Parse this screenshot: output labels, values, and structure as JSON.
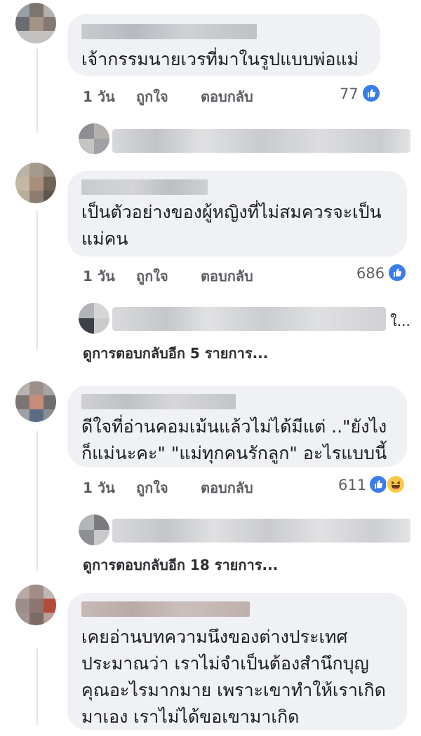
{
  "comments": [
    {
      "text": "เจ้ากรรมนายเวรที่มาในรูปแบบพ่อแม่",
      "time": "1 วัน",
      "like": "ถูกใจ",
      "reply": "ตอบกลับ",
      "reaction_count": "77"
    },
    {
      "text": "เป็นตัวอย่างของผู้หญิงที่ไม่สมควรจะเป็น\nแม่คน",
      "time": "1 วัน",
      "like": "ถูกใจ",
      "reply": "ตอบกลับ",
      "reaction_count": "686",
      "reply_preview_suffix": "ใ...",
      "more_replies": "ดูการตอบกลับอีก 5 รายการ..."
    },
    {
      "text": "ดีใจที่อ่านคอมเม้นแล้วไม่ได้มีแต่ ..\"ยังไง\nก็แม่นะคะ\" \"แม่ทุกคนรักลูก\"  อะไรแบบนี้",
      "time": "1 วัน",
      "like": "ถูกใจ",
      "reply": "ตอบกลับ",
      "reaction_count": "611",
      "more_replies": "ดูการตอบกลับอีก 18 รายการ..."
    },
    {
      "text": "เคยอ่านบทความนึงของต่างประเทศ\nประมาณว่า เราไม่จำเป็นต้องสำนึกบุญ\nคุณอะไรมากมาย เพราะเขาทำให้เราเกิด\nมาเอง เราไม่ได้ขอเขามาเกิด"
    }
  ],
  "icons": {
    "like": "thumbs-up-icon",
    "haha": "laughing-face-icon"
  },
  "colors": {
    "bubble": "#eff1f4",
    "like_blue": "#3b7de8",
    "meta_text": "#5c5f64"
  }
}
